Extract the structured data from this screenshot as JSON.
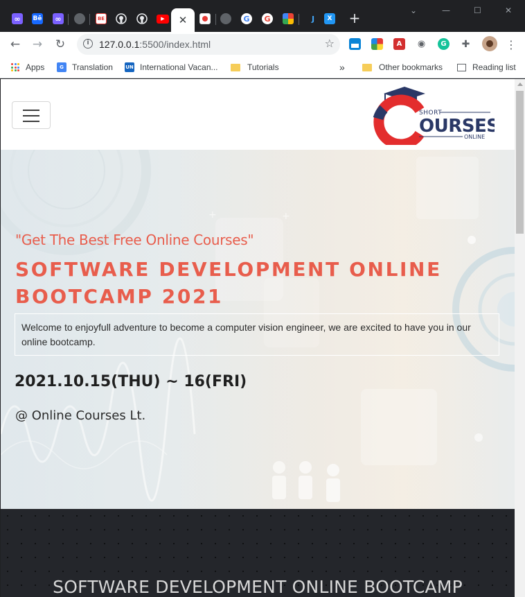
{
  "browser": {
    "tabs": [
      {
        "icon": "meta-icon",
        "color": "#7b61ff",
        "glyph": "∞"
      },
      {
        "icon": "behance-icon",
        "color": "#1769ff",
        "glyph": "Bē"
      },
      {
        "icon": "meta-icon",
        "color": "#7b61ff",
        "glyph": "∞"
      },
      {
        "icon": "globe-icon",
        "color": "#5f6368",
        "glyph": ""
      },
      {
        "icon": "be-icon",
        "color": "#e53935",
        "glyph": "BE"
      },
      {
        "icon": "github-icon",
        "color": "#ffffff",
        "glyph": ""
      },
      {
        "icon": "github-icon",
        "color": "#ffffff",
        "glyph": ""
      },
      {
        "icon": "youtube-icon",
        "color": "#ff0000",
        "glyph": "▶"
      },
      {
        "icon": "unknown-site-icon",
        "color": "#e53935",
        "glyph": ""
      },
      {
        "icon": "globe-icon",
        "color": "#5f6368",
        "glyph": ""
      },
      {
        "icon": "google-icon",
        "color": "#ffffff",
        "glyph": "G"
      },
      {
        "icon": "google-icon",
        "color": "#ffffff",
        "glyph": "G"
      },
      {
        "icon": "colorful-app-icon",
        "color": "#fbbc04",
        "glyph": ""
      },
      {
        "icon": "java-icon",
        "color": "#1565c0",
        "glyph": "J"
      },
      {
        "icon": "xd-icon",
        "color": "#2196f3",
        "glyph": "X"
      }
    ],
    "active_tab_close": "✕",
    "new_tab": "+",
    "window_controls": {
      "minimize": "—",
      "maximize": "☐",
      "close": "✕"
    },
    "toolbar": {
      "back": "←",
      "forward": "→",
      "reload": "↻",
      "info": "i",
      "url_host": "127.0.0.1",
      "url_path": ":5500/index.html",
      "star": "☆",
      "menu": "⋮"
    },
    "bookmarks": [
      {
        "label": "Apps",
        "icon": "apps-grid-icon"
      },
      {
        "label": "Translation",
        "icon": "google-translate-icon"
      },
      {
        "label": "International Vacan...",
        "icon": "uni-icon"
      },
      {
        "label": "Tutorials",
        "icon": "folder-icon"
      }
    ],
    "bookmarks_overflow": "»",
    "other_bookmarks": "Other bookmarks",
    "reading_list": "Reading list"
  },
  "site": {
    "logo": {
      "short": "SHORT",
      "courses": "OURSES",
      "online": "ONLINE",
      "letter": "C"
    },
    "hero": {
      "tagline": "\"Get The Best Free Online Courses\"",
      "title": "SOFTWARE DEVELOPMENT ONLINE BOOTCAMP 2021",
      "welcome": "Welcome to enjoyfull adventure to become a computer vision engineer, we are excited to have you in our online bootcamp.",
      "date": "2021.10.15(THU) ~ 16(FRI)",
      "venue": "@ Online Courses Lt."
    },
    "section": {
      "title": "SOFTWARE DEVELOPMENT ONLINE BOOTCAMP"
    }
  }
}
